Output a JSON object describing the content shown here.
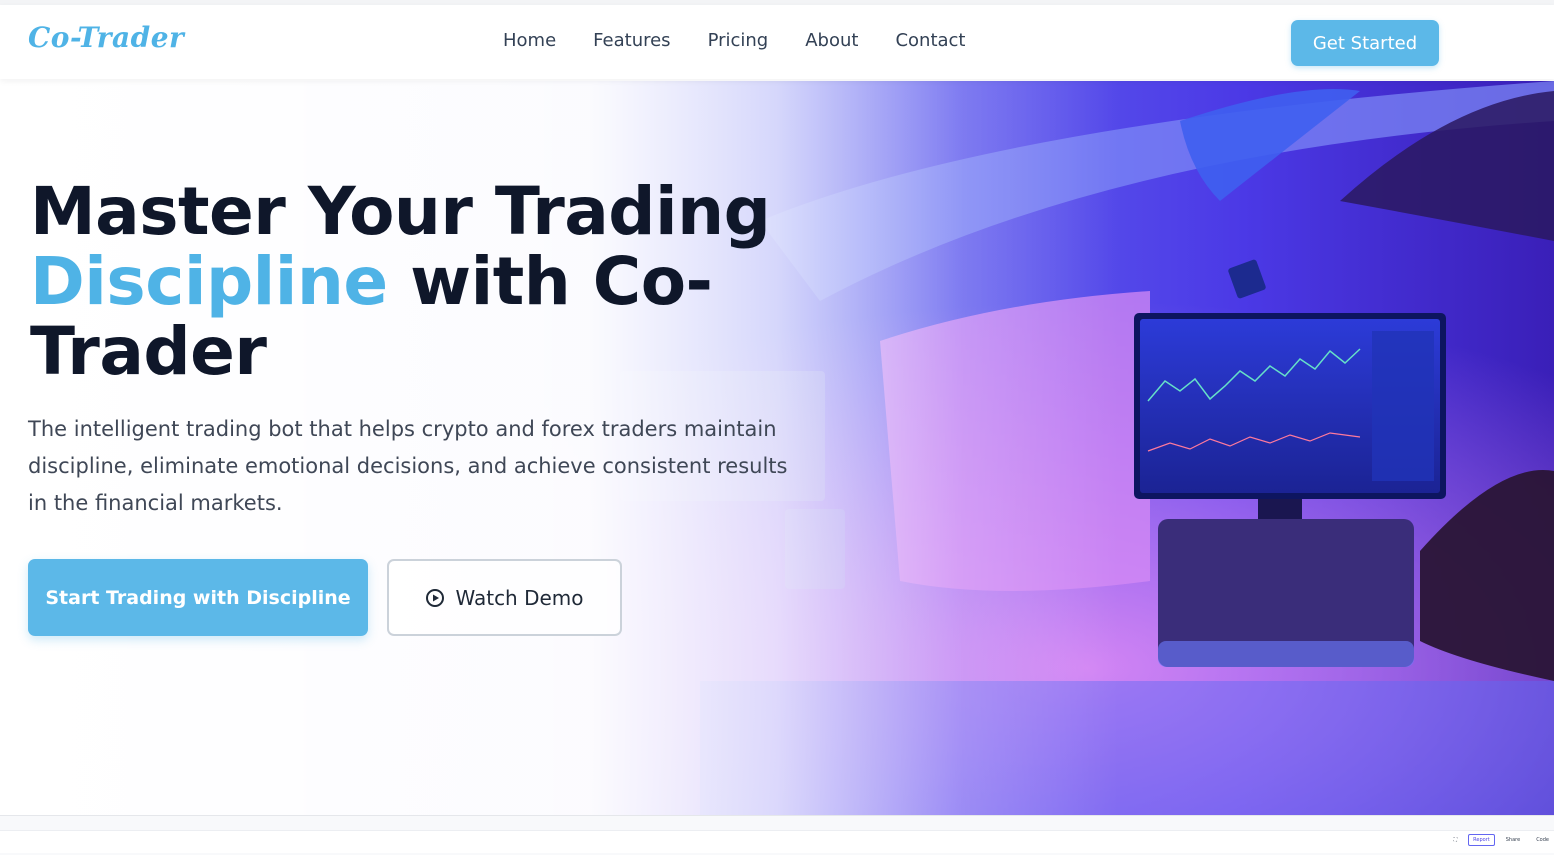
{
  "brand": {
    "logo": "Co-Trader",
    "accent": "#4fb3e6"
  },
  "nav": {
    "links": [
      "Home",
      "Features",
      "Pricing",
      "About",
      "Contact"
    ],
    "cta": "Get Started"
  },
  "hero": {
    "headline_line1": "Master Your Trading",
    "headline_accent": "Discipline",
    "headline_rest": " with Co-Trader",
    "subtitle": "The intelligent trading bot that helps crypto and forex traders maintain discipline, eliminate emotional decisions, and achieve consistent results in the financial markets.",
    "primary_button": "Start Trading with Discipline",
    "secondary_button": "Watch Demo",
    "secondary_icon": "play-circle-icon"
  },
  "footer_tools": [
    "Report",
    "Share",
    "Code"
  ],
  "colors": {
    "primary": "#5cb8e8",
    "heading": "#0f172a",
    "body": "#3f4756",
    "bg_purple": "#5b3df0"
  }
}
